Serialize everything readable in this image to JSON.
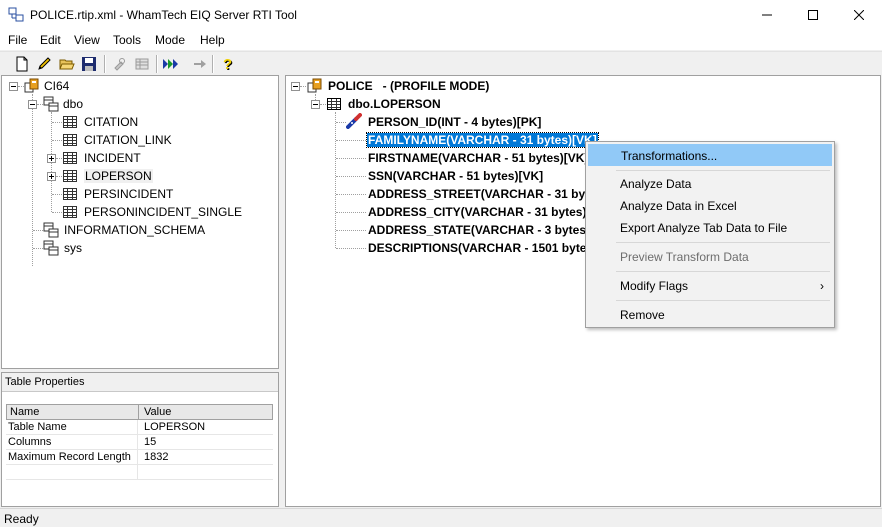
{
  "window": {
    "title": "POLICE.rtip.xml - WhamTech EIQ Server RTI Tool"
  },
  "menu": [
    "File",
    "Edit",
    "View",
    "Tools",
    "Mode",
    "Help"
  ],
  "left_tree": {
    "root": "CI64",
    "schema": "dbo",
    "tables": [
      "CITATION",
      "CITATION_LINK",
      "INCIDENT",
      "LOPERSON",
      "PERSINCIDENT",
      "PERSONINCIDENT_SINGLE"
    ],
    "schemas_other": [
      "INFORMATION_SCHEMA",
      "sys"
    ]
  },
  "properties": {
    "title": "Table Properties",
    "col_name": "Name",
    "col_value": "Value",
    "rows": [
      {
        "name": "Table Name",
        "value": "LOPERSON"
      },
      {
        "name": "Columns",
        "value": "15"
      },
      {
        "name": "Maximum Record Length",
        "value": "1832"
      }
    ]
  },
  "right_tree": {
    "root": "POLICE   - (PROFILE MODE)",
    "table": "dbo.LOPERSON",
    "columns": [
      "PERSON_ID(INT - 4 bytes)[PK]",
      "FAMILYNAME(VARCHAR - 31 bytes)[VK]",
      "FIRSTNAME(VARCHAR - 51 bytes)[VK]",
      "SSN(VARCHAR - 51 bytes)[VK]",
      "ADDRESS_STREET(VARCHAR - 31 bytes",
      "ADDRESS_CITY(VARCHAR - 31 bytes)[V",
      "ADDRESS_STATE(VARCHAR - 3 bytes)[V",
      "DESCRIPTIONS(VARCHAR - 1501 bytes"
    ]
  },
  "context_menu": {
    "items": [
      "Transformations...",
      "Analyze Data",
      "Analyze Data in Excel",
      "Export Analyze Tab Data to File",
      "Preview Transform Data",
      "Modify Flags",
      "Remove"
    ],
    "submenu_arrow": "›"
  },
  "status": {
    "text": "Ready"
  },
  "colors": {
    "selection": "#0078d7",
    "menu_highlight": "#91c9f7"
  }
}
